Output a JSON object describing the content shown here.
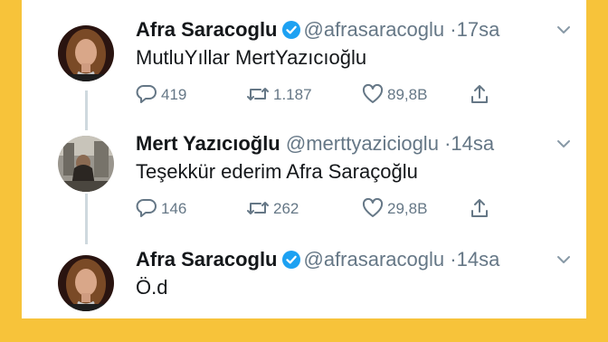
{
  "tweets": [
    {
      "name": "Afra Saracoglu",
      "verified": true,
      "handle": "@afrasaracoglu",
      "separator": "·",
      "time": "17sa",
      "text": "MutluYıllar MertYazıcıoğlu",
      "replies": "419",
      "retweets": "1.187",
      "likes": "89,8B"
    },
    {
      "name": "Mert Yazıcıoğlu",
      "verified": false,
      "handle": "@merttyazicioglu",
      "separator": "·",
      "time": "14sa",
      "text": "Teşekkür ederim Afra Saraçoğlu",
      "replies": "146",
      "retweets": "262",
      "likes": "29,8B"
    },
    {
      "name": "Afra Saracoglu",
      "verified": true,
      "handle": "@afrasaracoglu",
      "separator": "·",
      "time": "14sa",
      "text": "Ö.d"
    }
  ],
  "colors": {
    "frame_background": "#f7c33a",
    "verified_badge": "#1da1f2",
    "muted_text": "#657786",
    "thread_line": "#cfd9de"
  },
  "icons": [
    "reply-icon",
    "retweet-icon",
    "like-icon",
    "share-icon",
    "chevron-down-icon",
    "verified-badge-icon"
  ]
}
